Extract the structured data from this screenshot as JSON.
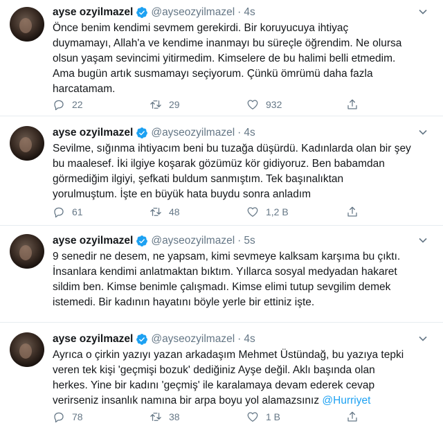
{
  "tweets": [
    {
      "name": "ayse ozyilmazel",
      "handle": "@ayseozyilmazel",
      "sep": "·",
      "time": "4s",
      "text": "Önce benim kendimi sevmem gerekirdi. Bir koruyucuya ihtiyaç\nduymamayı, Allah'a ve kendime inanmayı bu süreçle öğrendim. Ne olursa\nolsun yaşam sevincimi yitirmedim. Kimselere de bu halimi belli etmedim.\nAma bugün artık susmamayı seçiyorum. Çünkü ömrümü daha fazla\nharcatamam.",
      "replies": "22",
      "retweets": "29",
      "likes": "932"
    },
    {
      "name": "ayse ozyilmazel",
      "handle": "@ayseozyilmazel",
      "sep": "·",
      "time": "4s",
      "text": "Sevilme, sığınma ihtiyacım beni bu tuzağa düşürdü. Kadınlarda olan bir şey\nbu maalesef. İki ilgiye koşarak gözümüz kör gidiyoruz. Ben babamdan\ngörmediğim ilgiyi, şefkati buldum sanmıştım. Tek başınalıktan\nyorulmuştum. İşte en büyük hata buydu sonra anladım",
      "replies": "61",
      "retweets": "48",
      "likes": "1,2 B"
    },
    {
      "name": "ayse ozyilmazel",
      "handle": "@ayseozyilmazel",
      "sep": "·",
      "time": "5s",
      "text": "9 senedir ne desem, ne yapsam, kimi sevmeye kalksam karşıma bu çıktı.\nİnsanlara kendimi anlatmaktan bıktım. Yıllarca sosyal medyadan hakaret\nsildim ben. Kimse benimle çalışmadı. Kimse elimi tutup sevgilim demek\nistemedi. Bir kadının hayatını böyle yerle bir ettiniz işte."
    },
    {
      "name": "ayse ozyilmazel",
      "handle": "@ayseozyilmazel",
      "sep": "·",
      "time": "4s",
      "text": "Ayrıca o çirkin yazıyı yazan arkadaşım Mehmet Üstündağ, bu yazıya tepki\nveren tek kişi 'geçmişi bozuk' dediğiniz Ayşe değil. Aklı başında olan\nherkes. Yine bir kadını 'geçmiş' ile karalamaya devam ederek cevap\nverirseniz insanlık namına bir arpa boyu yol alamazsınız ",
      "mention": "@Hurriyet",
      "replies": "78",
      "retweets": "38",
      "likes": "1 B"
    }
  ],
  "icons": {
    "verified": "verified-badge-icon",
    "chevron": "chevron-down-icon",
    "reply": "reply-icon",
    "retweet": "retweet-icon",
    "like": "heart-icon",
    "share": "share-icon"
  },
  "colors": {
    "verified": "#1da1f2",
    "link": "#1da1f2",
    "muted": "#657786",
    "divider": "#e6ecf0"
  }
}
